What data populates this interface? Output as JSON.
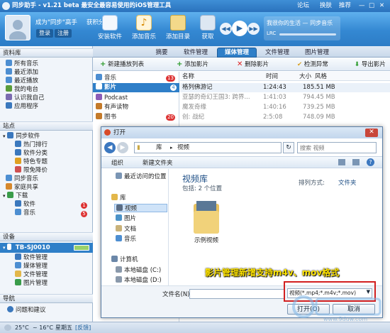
{
  "titlebar": {
    "title": "同步助手 - v1.21 beta  最安全最容易使用的iOS管理工具",
    "links": [
      "论坛",
      "换肤",
      "推荐",
      "—",
      "□",
      "✕"
    ]
  },
  "user": {
    "name": "成为\"同步\"高手",
    "reward": "获积分",
    "login": "登录",
    "register": "注册"
  },
  "toolbar": {
    "buttons": [
      "安装软件",
      "添加音乐",
      "添加目录",
      "获取"
    ]
  },
  "player": {
    "song": "我很你的生活 — 同步音乐",
    "lrc": "LRC"
  },
  "tabs": [
    "摘要",
    "软件管理",
    "媒体管理",
    "文件管理",
    "图片管理"
  ],
  "sidebar": {
    "library": "资料库",
    "library_items": [
      "所有音乐",
      "最近添加",
      "最近播放",
      "我的电台",
      "认识我自己",
      "应用程序"
    ],
    "store": "站点",
    "sync_soft": "同步软件",
    "store_items": [
      "热门排行",
      "软件分类",
      "特色专题",
      "限免降价"
    ],
    "store_more": [
      "同步音乐",
      "家庭共享"
    ],
    "download": "下载",
    "download_count": "1",
    "download_items": [
      "软件",
      "音乐"
    ],
    "download_soft_count": "5",
    "device": "设备",
    "device_name": "TB-SJ0010",
    "device_items": [
      "软件管理",
      "媒体管理",
      "文件管理",
      "图片管理"
    ],
    "nav": "导航",
    "help": "问题和建议"
  },
  "media_toolbar": [
    "新建播放列表",
    "添加影片",
    "删除影片",
    "检测异常",
    "导出影片"
  ],
  "media_categories": [
    {
      "label": "音乐",
      "count": "13"
    },
    {
      "label": "影片",
      "count": "4"
    },
    {
      "label": "Podcast",
      "count": ""
    },
    {
      "label": "有声读物",
      "count": ""
    },
    {
      "label": "图书",
      "count": "20"
    }
  ],
  "table": {
    "headers": [
      "名称",
      "时间",
      "大小",
      "风格"
    ],
    "rows": [
      [
        "格列佛游记",
        "1:24:43",
        "185.51 MB",
        ""
      ],
      [
        "亚瑟的奇幻王国3: 跨界...",
        "1:41:03",
        "794.45 MB",
        ""
      ],
      [
        "魔发奇缘",
        "1:40:16",
        "739.25 MB",
        ""
      ],
      [
        "创: 战纪",
        "2:5:08",
        "748.09 MB",
        ""
      ]
    ]
  },
  "dialog": {
    "title": "打开",
    "path": [
      "库",
      "视频"
    ],
    "search_placeholder": "搜索 视频",
    "organize": "组织",
    "new_folder": "新建文件夹",
    "nav_recent": "最近访问的位置",
    "nav_libs": "库",
    "nav_items": [
      "视频",
      "图片",
      "文档",
      "音乐"
    ],
    "computer": "计算机",
    "drives": [
      "本地磁盘 (C:)",
      "本地磁盘 (D:)"
    ],
    "lib_title": "视频库",
    "lib_sub": "包括: 2 个位置",
    "arrange_label": "排列方式:",
    "arrange_value": "文件夹",
    "folder_label": "示例视频",
    "filename_label": "文件名(N):",
    "filter": "视频(*.mp4;*.m4v;*.mov)",
    "open": "打开(O)",
    "cancel": "取消"
  },
  "annotation": "影片管理新增支持m4v、mov格式",
  "status": {
    "temp1": "25°C",
    "temp2": "~ 16°C",
    "weekday": "星期五",
    "feedback": "[反馈]"
  },
  "watermark": {
    "site": "www.9duw.com"
  },
  "colors": {
    "accent": "#2f7fc8",
    "annotation": "#ffe400",
    "highlight_border": "#d22020"
  }
}
